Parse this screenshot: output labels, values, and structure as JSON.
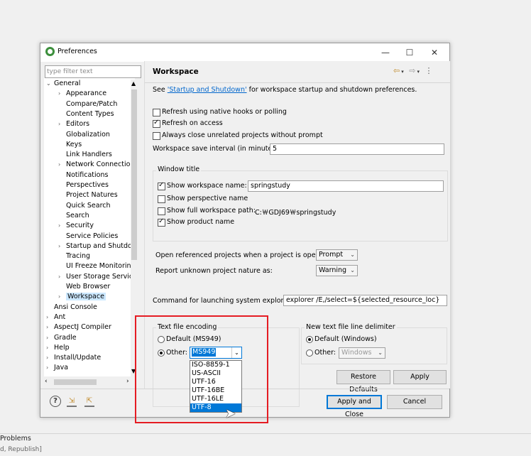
{
  "background": {
    "bottom_tab": "Problems",
    "bottom_status": "d, Republish]"
  },
  "dialog": {
    "title": "Preferences",
    "window_buttons": {
      "minimize": "—",
      "maximize": "☐",
      "close": "✕"
    },
    "filter_placeholder": "type filter text",
    "tree": [
      {
        "label": "General",
        "expanded": true
      },
      {
        "label": "Appearance",
        "arrow": true
      },
      {
        "label": "Compare/Patch"
      },
      {
        "label": "Content Types"
      },
      {
        "label": "Editors",
        "arrow": true
      },
      {
        "label": "Globalization"
      },
      {
        "label": "Keys"
      },
      {
        "label": "Link Handlers"
      },
      {
        "label": "Network Connection",
        "arrow": true
      },
      {
        "label": "Notifications"
      },
      {
        "label": "Perspectives"
      },
      {
        "label": "Project Natures"
      },
      {
        "label": "Quick Search"
      },
      {
        "label": "Search"
      },
      {
        "label": "Security",
        "arrow": true
      },
      {
        "label": "Service Policies"
      },
      {
        "label": "Startup and Shutdow",
        "arrow": true
      },
      {
        "label": "Tracing"
      },
      {
        "label": "UI Freeze Monitoring"
      },
      {
        "label": "User Storage Service",
        "arrow": true
      },
      {
        "label": "Web Browser"
      },
      {
        "label": "Workspace",
        "arrow": true,
        "selected": true
      },
      {
        "label": "Ansi Console"
      },
      {
        "label": "Ant",
        "arrow": true
      },
      {
        "label": "AspectJ Compiler",
        "arrow": true
      },
      {
        "label": "Gradle",
        "arrow": true
      },
      {
        "label": "Help",
        "arrow": true
      },
      {
        "label": "Install/Update",
        "arrow": true
      },
      {
        "label": "Java",
        "arrow": true
      }
    ],
    "page": {
      "title": "Workspace",
      "intro_prefix": "See ",
      "intro_link": "'Startup and Shutdown'",
      "intro_suffix": " for workspace startup and shutdown preferences.",
      "checkboxes": [
        {
          "label": "Refresh using native hooks or polling",
          "checked": false
        },
        {
          "label": "Refresh on access",
          "checked": true
        },
        {
          "label": "Always close unrelated projects without prompt",
          "checked": false
        }
      ],
      "save_interval_label": "Workspace save interval (in minutes):",
      "save_interval_value": "5",
      "window_title": {
        "legend": "Window title",
        "show_name_label": "Show workspace name:",
        "show_name_checked": true,
        "name_value": "springstudy",
        "show_perspective_label": "Show perspective name",
        "show_path_label": "Show full workspace path:",
        "path_value": "C:￦GDJ69￦springstudy",
        "show_product_label": "Show product name"
      },
      "open_ref_label": "Open referenced projects when a project is opened:",
      "open_ref_value": "Prompt",
      "report_label": "Report unknown project nature as:",
      "report_value": "Warning",
      "explorer_label": "Command for launching system explorer:",
      "explorer_value": "explorer /E,/select=${selected_resource_loc}",
      "encoding": {
        "legend": "Text file encoding",
        "default_label": "Default (MS949)",
        "other_label": "Other:",
        "other_value": "MS949",
        "options": [
          "ISO-8859-1",
          "US-ASCII",
          "UTF-16",
          "UTF-16BE",
          "UTF-16LE",
          "UTF-8"
        ],
        "highlighted": "UTF-8"
      },
      "delimiter": {
        "legend": "New text file line delimiter",
        "default_label": "Default (Windows)",
        "other_label": "Other:",
        "other_value": "Windows"
      },
      "restore_defaults": "Restore Defaults",
      "apply": "Apply"
    },
    "apply_and_close": "Apply and Close",
    "cancel": "Cancel"
  }
}
